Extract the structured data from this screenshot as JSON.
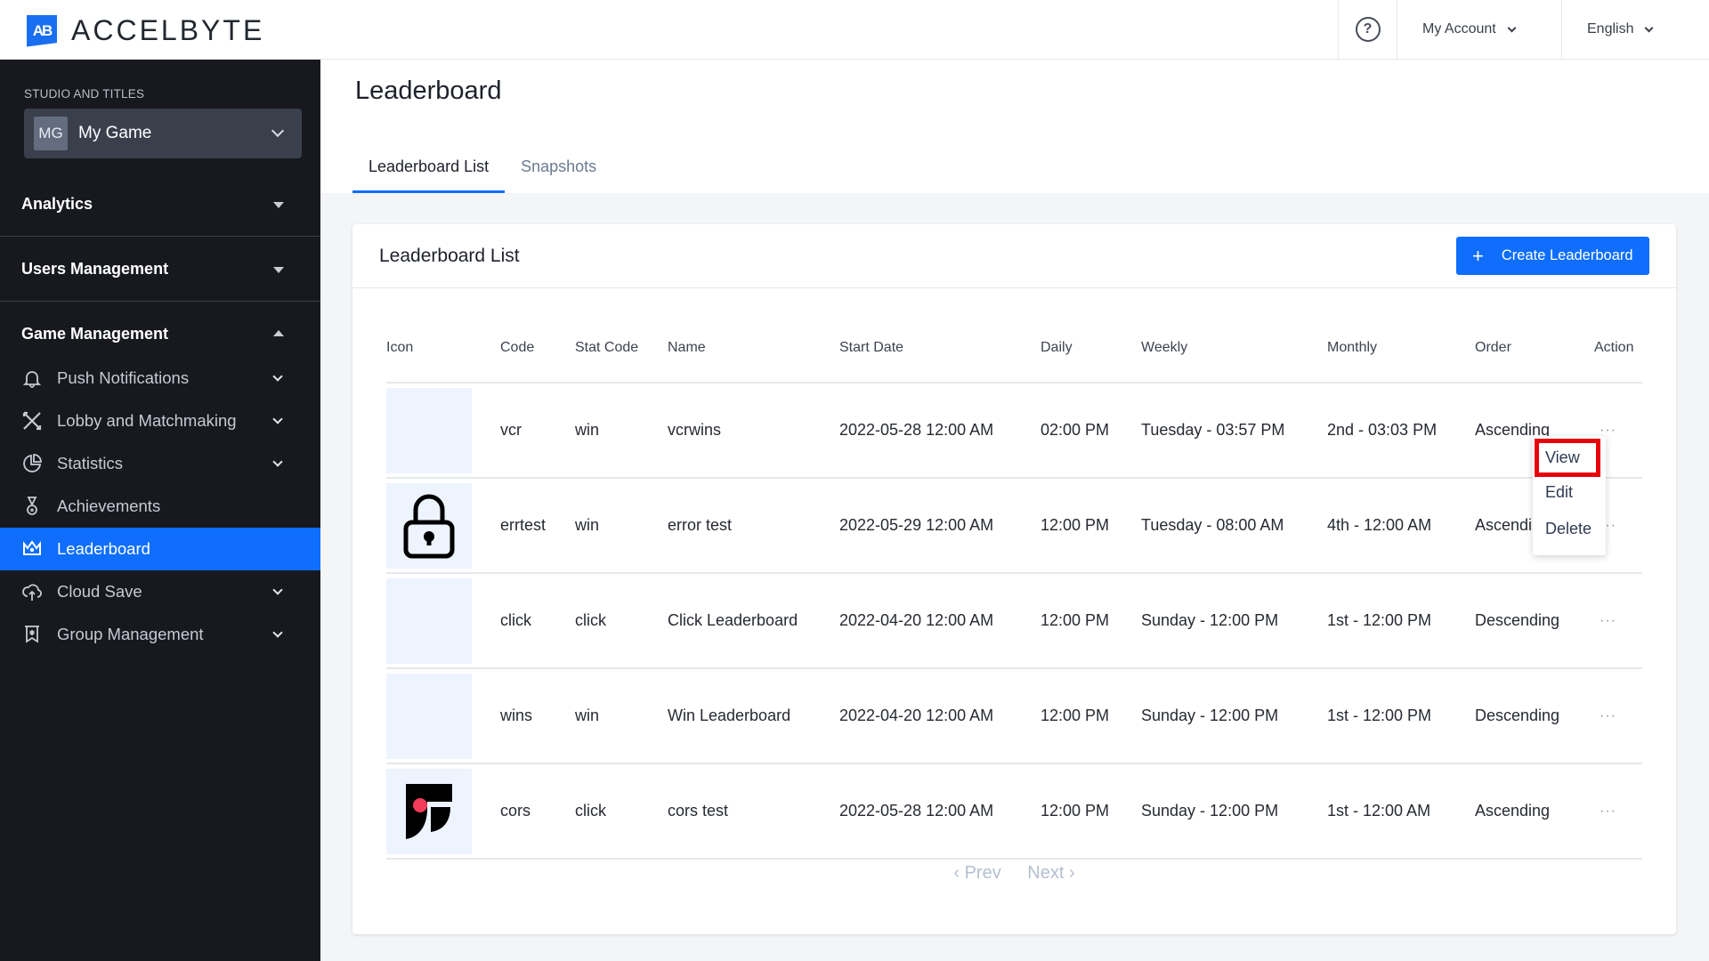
{
  "header": {
    "brand": "ACCELBYTE",
    "brand_mark": "AB",
    "help_icon": "question-circle-icon",
    "account_label": "My Account",
    "language_label": "English"
  },
  "sidebar": {
    "studio_label": "STUDIO AND TITLES",
    "game": {
      "initials": "MG",
      "name": "My Game"
    },
    "sections": [
      {
        "label": "Analytics",
        "state": "collapsed"
      },
      {
        "label": "Users Management",
        "state": "collapsed"
      },
      {
        "label": "Game Management",
        "state": "expanded"
      }
    ],
    "items": [
      {
        "label": "Push Notifications",
        "icon": "bell-icon",
        "has_submenu": true
      },
      {
        "label": "Lobby and Matchmaking",
        "icon": "crossed-swords-icon",
        "has_submenu": true
      },
      {
        "label": "Statistics",
        "icon": "pie-chart-icon",
        "has_submenu": true
      },
      {
        "label": "Achievements",
        "icon": "medal-icon",
        "has_submenu": false
      },
      {
        "label": "Leaderboard",
        "icon": "crown-icon",
        "has_submenu": false,
        "active": true
      },
      {
        "label": "Cloud Save",
        "icon": "cloud-upload-icon",
        "has_submenu": true
      },
      {
        "label": "Group Management",
        "icon": "group-banner-icon",
        "has_submenu": true
      }
    ]
  },
  "page": {
    "title": "Leaderboard",
    "tabs": [
      {
        "label": "Leaderboard List",
        "active": true
      },
      {
        "label": "Snapshots",
        "active": false
      }
    ]
  },
  "card": {
    "title": "Leaderboard List",
    "create_button": "Create Leaderboard",
    "columns": [
      "Icon",
      "Code",
      "Stat Code",
      "Name",
      "Start Date",
      "Daily",
      "Weekly",
      "Monthly",
      "Order",
      "Action"
    ],
    "rows": [
      {
        "icon": "none",
        "code": "vcr",
        "stat_code": "win",
        "name": "vcrwins",
        "start_date": "2022-05-28 12:00 AM",
        "daily": "02:00 PM",
        "weekly": "Tuesday - 03:57 PM",
        "monthly": "2nd - 03:03 PM",
        "order": "Ascending",
        "action": "···"
      },
      {
        "icon": "lock-icon",
        "code": "errtest",
        "stat_code": "win",
        "name": "error test",
        "start_date": "2022-05-29 12:00 AM",
        "daily": "12:00 PM",
        "weekly": "Tuesday - 08:00 AM",
        "monthly": "4th - 12:00 AM",
        "order": "Ascending",
        "action": "···"
      },
      {
        "icon": "none",
        "code": "click",
        "stat_code": "click",
        "name": "Click Leaderboard",
        "start_date": "2022-04-20 12:00 AM",
        "daily": "12:00 PM",
        "weekly": "Sunday - 12:00 PM",
        "monthly": "1st - 12:00 PM",
        "order": "Descending",
        "action": "···"
      },
      {
        "icon": "none",
        "code": "wins",
        "stat_code": "win",
        "name": "Win Leaderboard",
        "start_date": "2022-04-20 12:00 AM",
        "daily": "12:00 PM",
        "weekly": "Sunday - 12:00 PM",
        "monthly": "1st - 12:00 PM",
        "order": "Descending",
        "action": "···"
      },
      {
        "icon": "brand-logo-icon",
        "code": "cors",
        "stat_code": "click",
        "name": "cors test",
        "start_date": "2022-05-28 12:00 AM",
        "daily": "12:00 PM",
        "weekly": "Sunday - 12:00 PM",
        "monthly": "1st - 12:00 AM",
        "order": "Ascending",
        "action": "···"
      }
    ],
    "action_menu": {
      "items": [
        "View",
        "Edit",
        "Delete"
      ],
      "highlighted": "View"
    },
    "pagination": {
      "prev": "‹ Prev",
      "next": "Next ›"
    }
  },
  "colors": {
    "accent": "#0f6efd",
    "sidebar_bg": "#17191f",
    "highlight_box": "#e8000b",
    "icon_placeholder_bg": "#edf4fe"
  }
}
